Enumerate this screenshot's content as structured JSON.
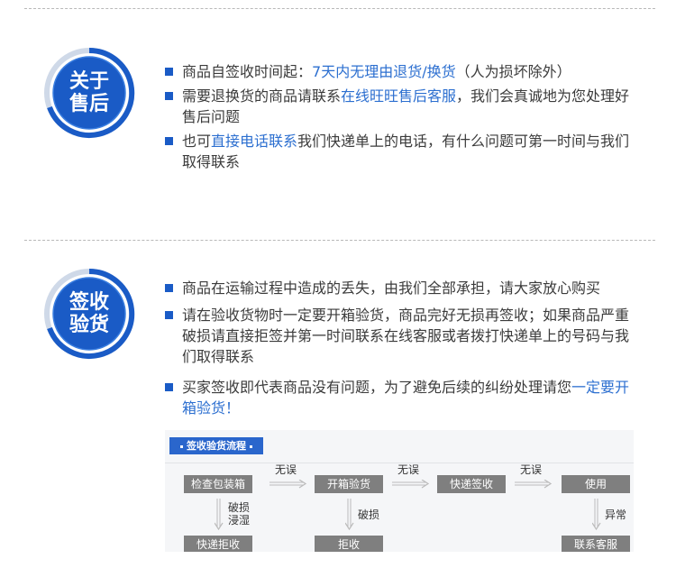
{
  "sections": [
    {
      "badge": {
        "line1": "关于",
        "line2": "售后"
      },
      "items": [
        {
          "parts": [
            {
              "t": "商品自签收时间起：",
              "hl": false
            },
            {
              "t": "7天内无理由退货/换货",
              "hl": true
            },
            {
              "t": "（人为损坏除外）",
              "hl": false
            }
          ]
        },
        {
          "parts": [
            {
              "t": "需要退换货的商品请联系",
              "hl": false
            },
            {
              "t": "在线旺旺售后客服",
              "hl": true
            },
            {
              "t": "，我们会真诚地为您处理好售后问题",
              "hl": false
            }
          ]
        },
        {
          "parts": [
            {
              "t": "也可",
              "hl": false
            },
            {
              "t": "直接电话联系",
              "hl": true
            },
            {
              "t": "我们快递单上的电话，有什么问题可第一时间与我们取得联系",
              "hl": false
            }
          ]
        }
      ]
    },
    {
      "badge": {
        "line1": "签收",
        "line2": "验货"
      },
      "items": [
        {
          "parts": [
            {
              "t": "商品在运输过程中造成的丢失，由我们全部承担，请大家放心购买",
              "hl": false
            }
          ]
        },
        {
          "parts": [
            {
              "t": "请在验收货物时一定要开箱验货，商品完好无损再签收；如果商品严重破损请直接拒签并第一时间联系在线客服或者拨打快递单上的号码与我们取得联系",
              "hl": false
            }
          ]
        },
        {
          "parts": [
            {
              "t": "买家签收即代表商品没有问题，为了避免后续的纠纷处理请您",
              "hl": false
            },
            {
              "t": "一定要开箱验货！",
              "hl": true
            }
          ]
        }
      ]
    }
  ],
  "flow": {
    "title": "签收验货流程",
    "steps": [
      "检查包装箱",
      "开箱验货",
      "快递签收",
      "使用"
    ],
    "ok_labels": [
      "无误",
      "无误",
      "无误"
    ],
    "branches": [
      {
        "label": "破损\n浸湿",
        "result": "快递拒收"
      },
      {
        "label": "破损",
        "result": "拒收"
      },
      {
        "label": "异常",
        "result": "联系客服"
      }
    ]
  },
  "colors": {
    "accent": "#2c6fd0",
    "badge_blue": "#1a5bc6",
    "box_gray": "#7f7f7f"
  }
}
